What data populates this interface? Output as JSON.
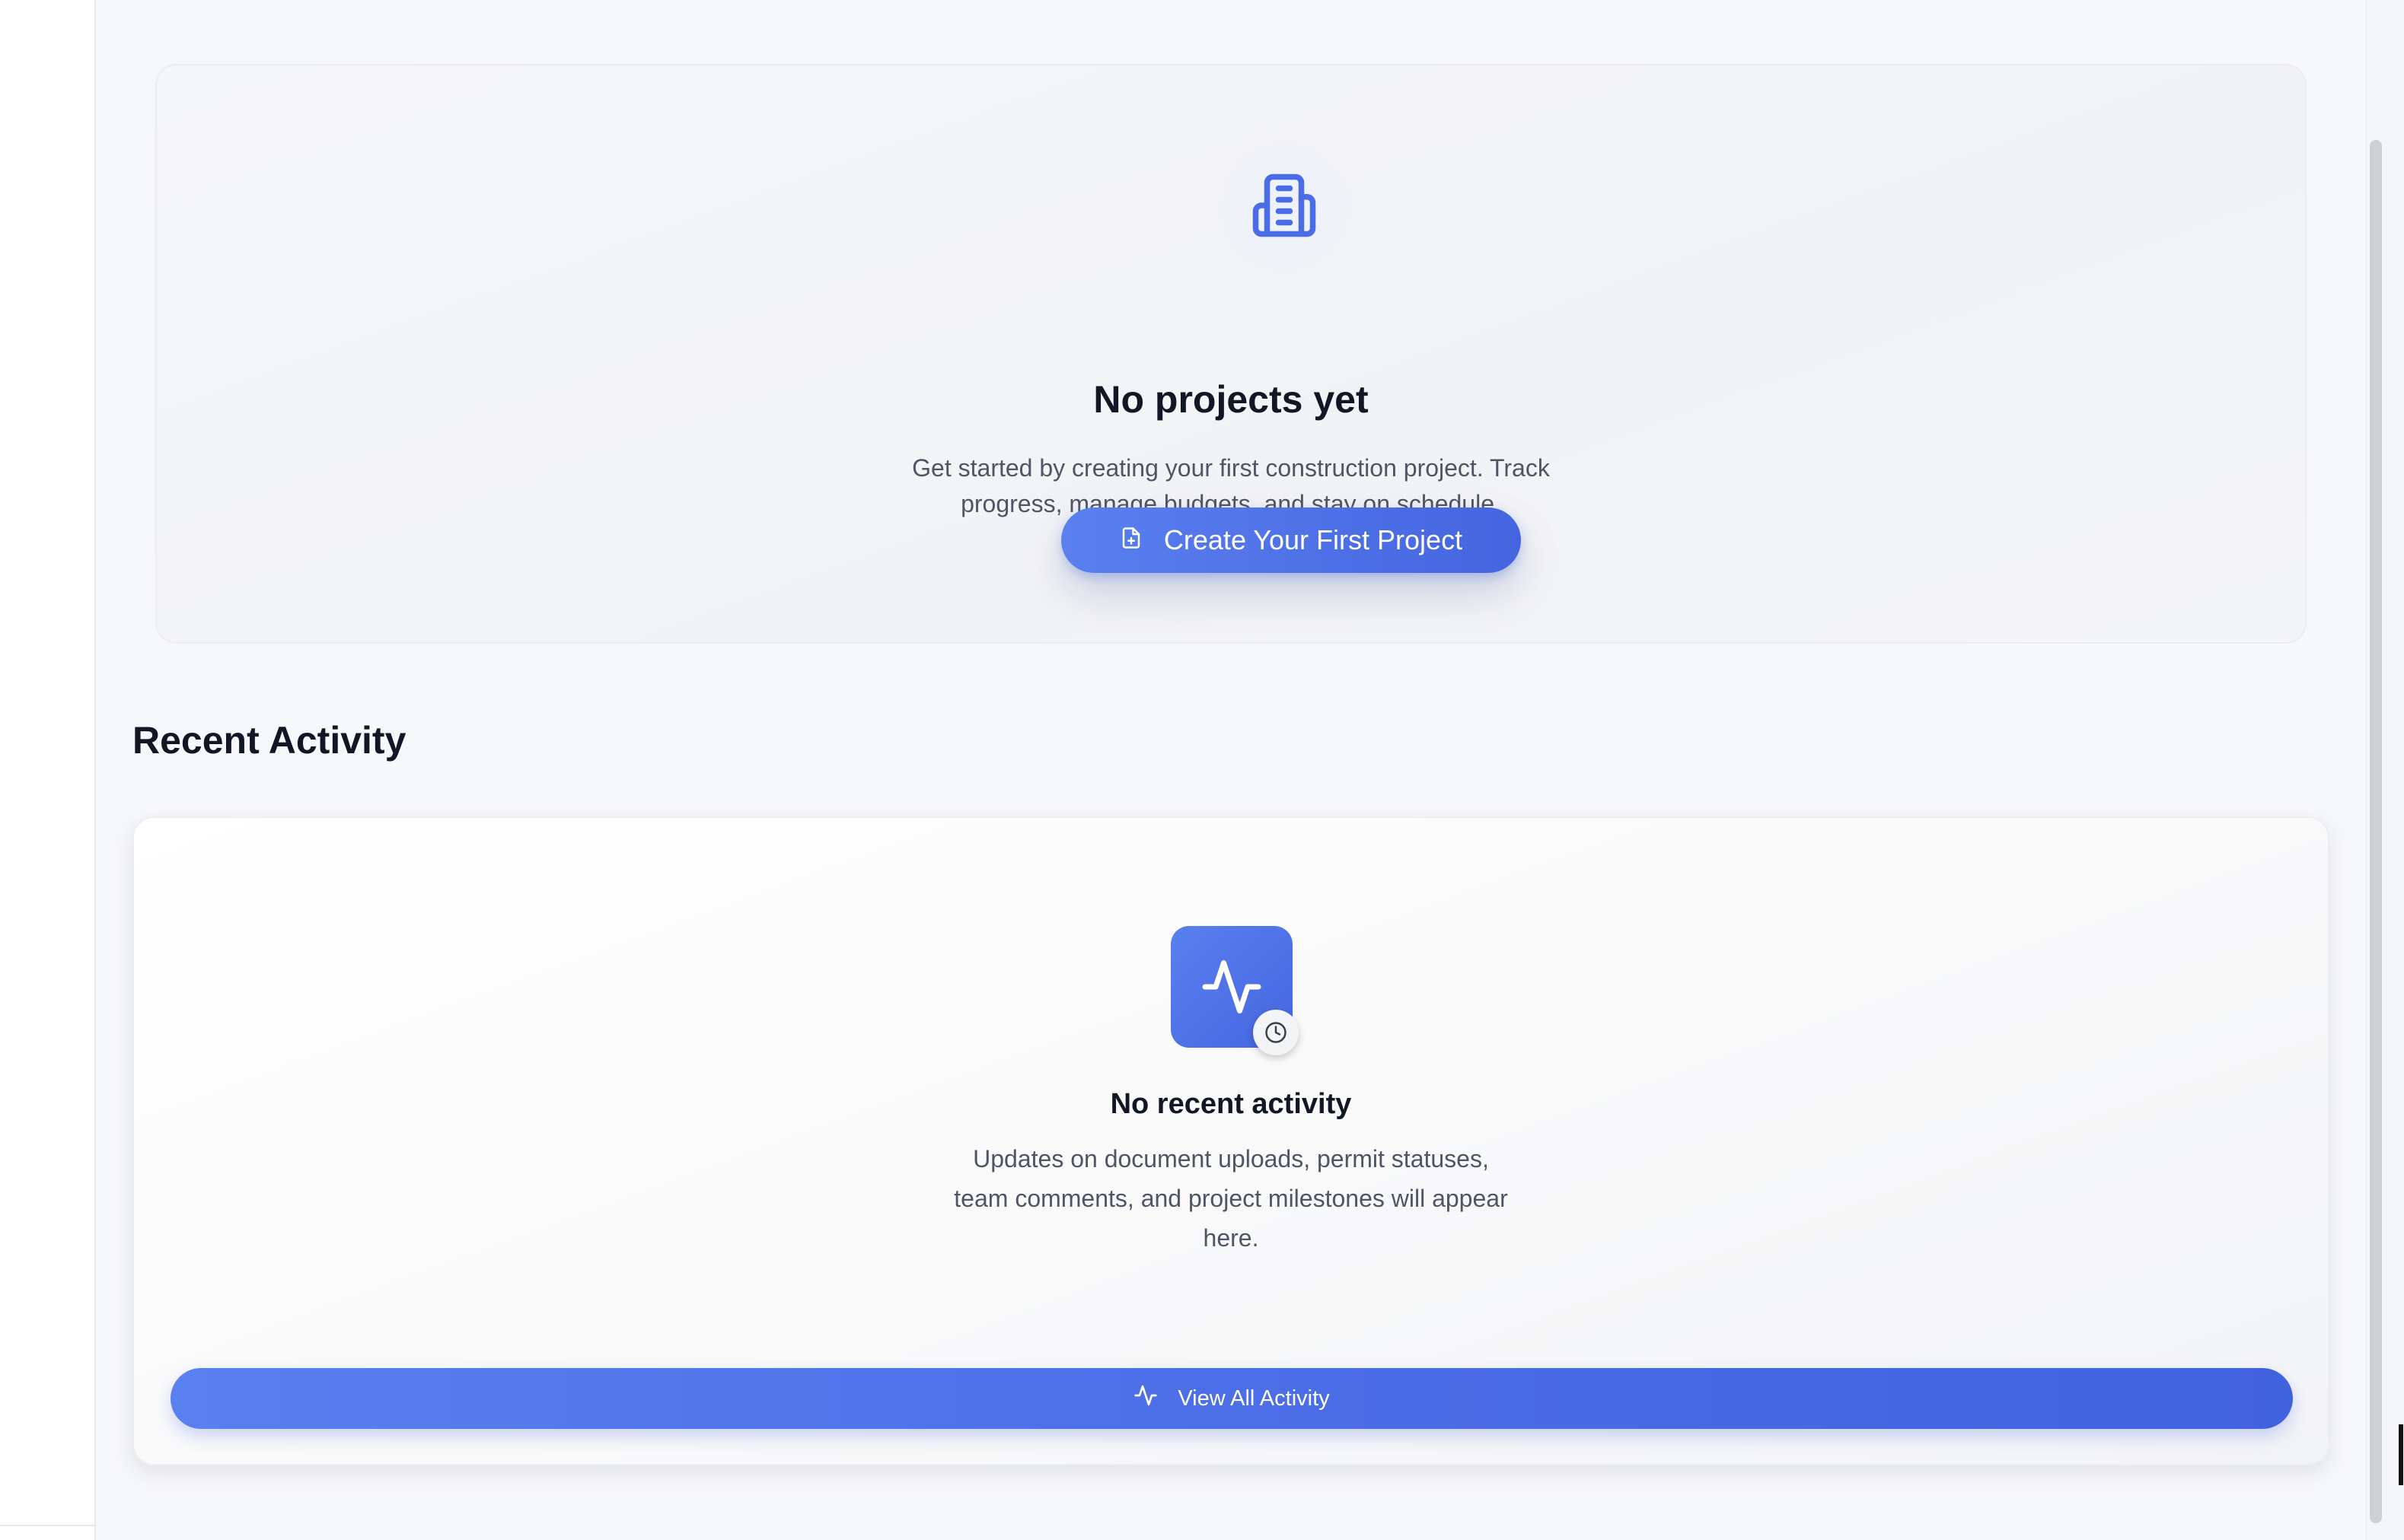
{
  "projects_empty": {
    "title": "No projects yet",
    "description": "Get started by creating your first construction project. Track progress, manage budgets, and stay on schedule.",
    "create_button_label": "Create Your First Project",
    "icon": "building-icon"
  },
  "recent_activity": {
    "section_title": "Recent Activity",
    "empty_title": "No recent activity",
    "empty_description": "Updates on document uploads, permit statuses, team comments, and project milestones will appear here.",
    "view_all_label": "View All Activity",
    "icons": [
      "activity-pulse-icon",
      "clock-icon"
    ]
  },
  "colors": {
    "accent": "#4a6ce6",
    "accent_light": "#5a80ef",
    "text_primary": "#121726",
    "text_secondary": "#4e5564",
    "page_bg": "#f7f8fb"
  }
}
